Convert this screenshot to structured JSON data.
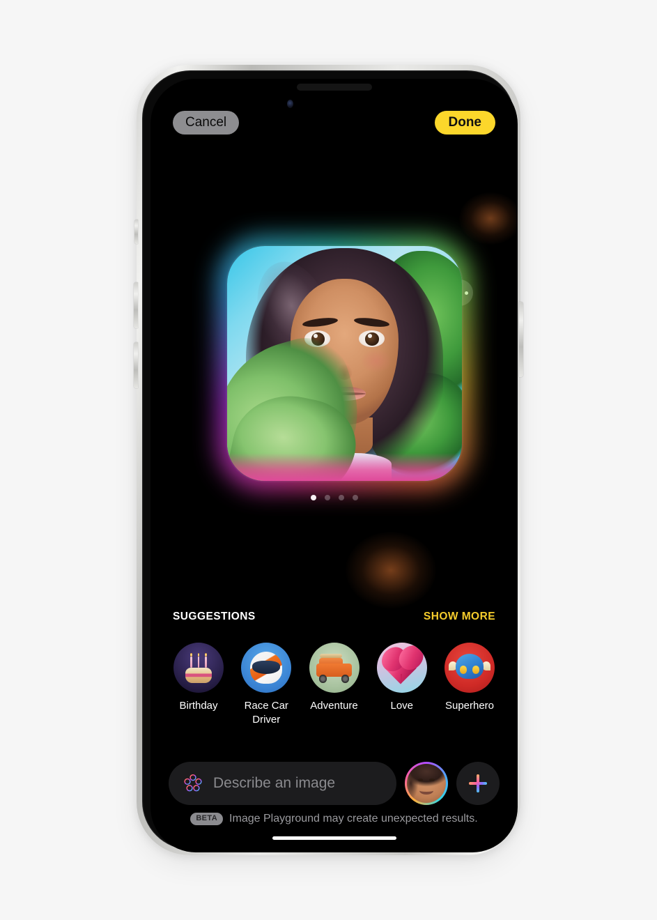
{
  "app": {
    "name": "Image Playground",
    "background_color": "#f6f6f6",
    "screen_background": "#000000"
  },
  "top_bar": {
    "cancel_label": "Cancel",
    "done_label": "Done",
    "done_color": "#fcd72b",
    "cancel_bg": "#8d8d90"
  },
  "canvas": {
    "more_button_name": "more-options",
    "image_alt": "Generated cartoon portrait of a smiling young woman with long curly dark hair surrounded by green leaves",
    "page_dots": {
      "count": 4,
      "active_index": 0
    }
  },
  "suggestions": {
    "title": "SUGGESTIONS",
    "show_more_label": "SHOW MORE",
    "show_more_color": "#f5cc2c",
    "items": [
      {
        "label": "Birthday",
        "icon": "birthday-cake-icon"
      },
      {
        "label": "Race Car Driver",
        "icon": "racing-helmet-icon"
      },
      {
        "label": "Adventure",
        "icon": "offroad-jeep-icon"
      },
      {
        "label": "Love",
        "icon": "heart-balloon-icon"
      },
      {
        "label": "Superhero",
        "icon": "superhero-mask-icon"
      }
    ]
  },
  "input_bar": {
    "placeholder": "Describe an image",
    "value": "",
    "sparkle_icon": "apple-intelligence-icon",
    "avatar_icon": "person-avatar",
    "add_icon": "plus-icon"
  },
  "footer": {
    "badge": "BETA",
    "disclaimer": "Image Playground may create unexpected results."
  }
}
